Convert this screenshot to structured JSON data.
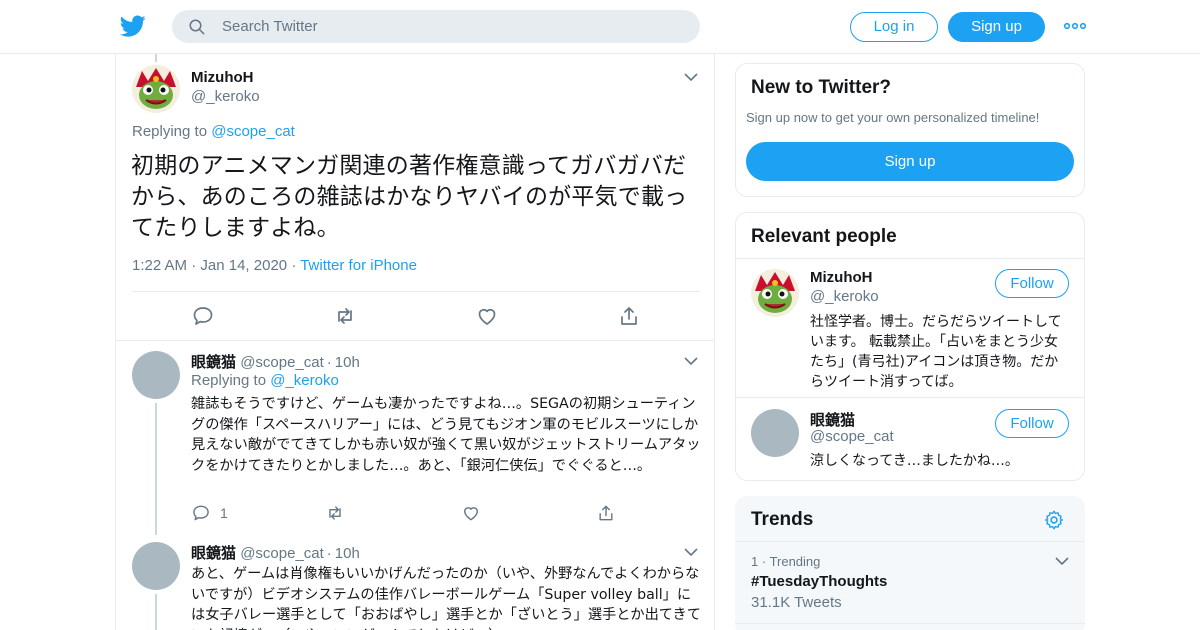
{
  "header": {
    "search_placeholder": "Search Twitter",
    "login_label": "Log in",
    "signup_label": "Sign up"
  },
  "main_tweet": {
    "name": "MizuhoH",
    "handle": "@_keroko",
    "replying_prefix": "Replying to ",
    "replying_to": "@scope_cat",
    "text": "初期のアニメマンガ関連の著作権意識ってガバガバだから、あのころの雑誌はかなりヤバイのが平気で載ってたりしますよね。",
    "time": "1:22 AM",
    "date": "Jan 14, 2020",
    "source": "Twitter for iPhone"
  },
  "replies": [
    {
      "name": "眼鏡猫",
      "handle": "@scope_cat",
      "age": "10h",
      "replying_prefix": "Replying to ",
      "replying_to": "@_keroko",
      "text": "雑誌もそうですけど、ゲームも凄かったですよね…。SEGAの初期シューティングの傑作「スペースハリアー」には、どう見てもジオン軍のモビルスーツにしか見えない敵がでてきてしかも赤い奴が強くて黒い奴がジェットストリームアタックをかけてきたりとかしました…。あと、「銀河仁侠伝」でぐぐると…。",
      "reply_count": "1"
    },
    {
      "name": "眼鏡猫",
      "handle": "@scope_cat",
      "age": "10h",
      "text": "あと、ゲームは肖像権もいいかげんだったのか（いや、外野なんでよくわからないですが）ビデオシステムの佳作バレーボールゲーム「Super volley ball」には女子バレー選手として「おおばやし」選手とか「ざいとう」選手とか出てきていた記憶が…（いや、いいゲームでしたけど…）"
    }
  ],
  "new_to_twitter": {
    "title": "New to Twitter?",
    "subtitle": "Sign up now to get your own personalized timeline!",
    "button": "Sign up"
  },
  "relevant_people": {
    "title": "Relevant people",
    "people": [
      {
        "name": "MizuhoH",
        "handle": "@_keroko",
        "follow_label": "Follow",
        "bio": "社怪学者。博士。だらだらツイートしています。 転載禁止。「占いをまとう少女たち」(青弓社)アイコンは頂き物。だからツイート消すってば。"
      },
      {
        "name": "眼鏡猫",
        "handle": "@scope_cat",
        "follow_label": "Follow",
        "bio": "涼しくなってき…ましたかね…。"
      }
    ]
  },
  "trends": {
    "title": "Trends",
    "items": [
      {
        "rank": "1",
        "context": "Trending",
        "name": "#TuesdayThoughts",
        "count": "31.1K Tweets"
      }
    ]
  },
  "colors": {
    "accent": "#1da1f2",
    "text": "#14171a",
    "secondary": "#657786",
    "border": "#e6ecf0"
  }
}
